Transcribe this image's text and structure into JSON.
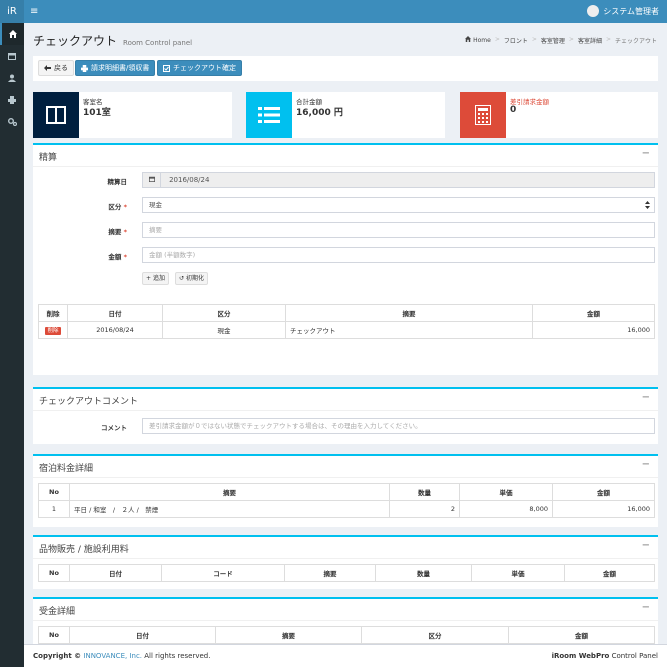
{
  "topbar": {
    "logo": "iR",
    "menu_glyph": "≡",
    "user_name": "システム管理者"
  },
  "sidebar": {
    "icons": [
      "home-icon",
      "calendar-icon",
      "user-icon",
      "printer-icon",
      "settings-icon"
    ]
  },
  "header": {
    "title": "チェックアウト",
    "subtitle": "Room Control panel"
  },
  "breadcrumb": {
    "home": "Home",
    "items": [
      "フロント",
      "客室管理",
      "客室詳細"
    ],
    "current": "チェックアウト",
    "sep": ">"
  },
  "toolbar": {
    "back_label": "戻る",
    "invoice_label": "請求明細書/領収書",
    "confirm_label": "チェックアウト確定"
  },
  "info_boxes": [
    {
      "label": "客室名",
      "value": "101室",
      "color": "#001f3f"
    },
    {
      "label": "合計金額",
      "value": "16,000 円",
      "color": "#00c0ef"
    },
    {
      "label": "差引請求金額",
      "value": "0",
      "color": "#dd4b39"
    }
  ],
  "settle": {
    "title": "精算",
    "collapse": "−",
    "date_label": "精算日",
    "date_value": "2016/08/24",
    "type_label": "区分",
    "type_value": "現金",
    "summary_label": "摘要",
    "summary_placeholder": "摘要",
    "amount_label": "金額",
    "amount_placeholder": "金額 (半額数字)",
    "required": "*",
    "add_label": "追加",
    "reset_label": "初期化",
    "table": {
      "headers": [
        "削除",
        "日付",
        "区分",
        "摘要",
        "金額"
      ],
      "rows": [
        {
          "del": "削除",
          "date": "2016/08/24",
          "type": "現金",
          "summary": "チェックアウト",
          "amount": "16,000"
        }
      ]
    }
  },
  "comment": {
    "title": "チェックアウトコメント",
    "collapse": "−",
    "label": "コメント",
    "placeholder": "差引請求金額が０ではない状態でチェックアウトする場合は、その理由を入力してください。"
  },
  "stay": {
    "title": "宿泊料金詳細",
    "collapse": "−",
    "headers": [
      "No",
      "摘要",
      "数量",
      "単価",
      "金額"
    ],
    "rows": [
      {
        "no": "1",
        "summary": "平日 / 和室　/　２人 /　禁煙",
        "qty": "2",
        "price": "8,000",
        "amount": "16,000"
      }
    ]
  },
  "goods": {
    "title": "品物販売 / 施設利用料",
    "collapse": "−",
    "headers": [
      "No",
      "日付",
      "コード",
      "摘要",
      "数量",
      "単価",
      "金額"
    ]
  },
  "receipt": {
    "title": "受金詳細",
    "collapse": "−",
    "headers": [
      "No",
      "日付",
      "摘要",
      "区分",
      "金額"
    ]
  },
  "footer": {
    "copyright": "Copyright ©",
    "company": "INNOVANCE, Inc.",
    "rights": "All rights reserved.",
    "product": "iRoom WebPro",
    "product_suffix": "Control Panel"
  }
}
